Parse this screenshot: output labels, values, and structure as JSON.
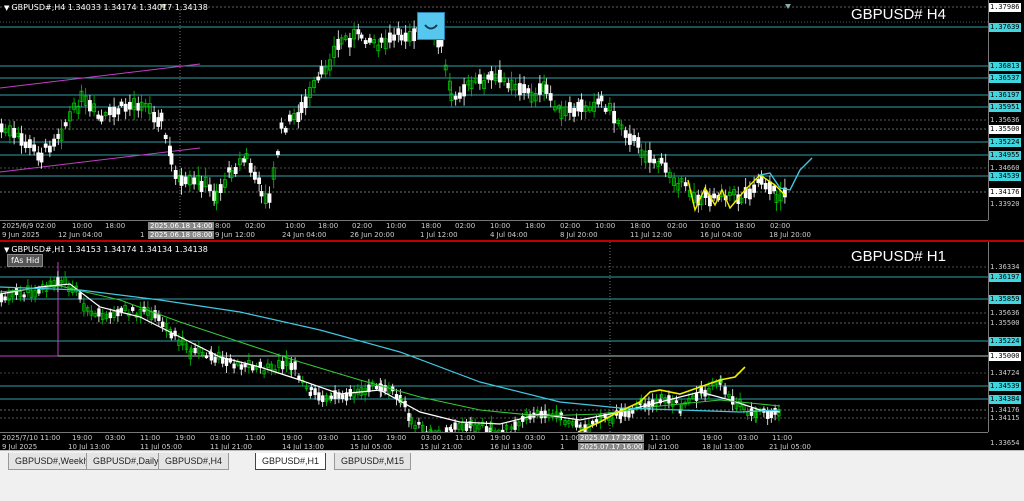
{
  "upper": {
    "header": "GBPUSD#,H4  1.34033 1.34174 1.34017 1.34138",
    "title": "GBPUSD# H4",
    "price_labels": [
      {
        "text": "1.37986",
        "style": "white"
      },
      {
        "text": "1.37639",
        "style": "cyan"
      },
      {
        "text": "1.36813",
        "style": "cyan"
      },
      {
        "text": "1.36537",
        "style": "cyan"
      },
      {
        "text": "1.36197",
        "style": "cyan"
      },
      {
        "text": "1.35951",
        "style": "cyan"
      },
      {
        "text": "1.35636",
        "style": "plain"
      },
      {
        "text": "1.35500",
        "style": "white"
      },
      {
        "text": "1.35224",
        "style": "cyan"
      },
      {
        "text": "1.34955",
        "style": "cyan"
      },
      {
        "text": "1.34660",
        "style": "plain"
      },
      {
        "text": "1.34539",
        "style": "cyan"
      },
      {
        "text": "1.34176",
        "style": "white"
      },
      {
        "text": "1.33920",
        "style": "plain"
      }
    ],
    "time_labels": [
      {
        "text": "2025/6/9 02:00",
        "hl": false
      },
      {
        "text": "10:00",
        "hl": false
      },
      {
        "text": "18:00",
        "hl": false
      },
      {
        "text": "2025.06.18 14:00",
        "hl": true
      },
      {
        "text": "8:00",
        "hl": false
      },
      {
        "text": "02:00",
        "hl": false
      },
      {
        "text": "10:00",
        "hl": false
      },
      {
        "text": "18:00",
        "hl": false
      },
      {
        "text": "02:00",
        "hl": false
      },
      {
        "text": "10:00",
        "hl": false
      },
      {
        "text": "18:00",
        "hl": false
      },
      {
        "text": "02:00",
        "hl": false
      },
      {
        "text": "10:00",
        "hl": false
      },
      {
        "text": "18:00",
        "hl": false
      },
      {
        "text": "02:00",
        "hl": false
      },
      {
        "text": "10:00",
        "hl": false
      },
      {
        "text": "18:00",
        "hl": false
      },
      {
        "text": "02:00",
        "hl": false
      },
      {
        "text": "10:00",
        "hl": false
      },
      {
        "text": "18:00",
        "hl": false
      },
      {
        "text": "02:00",
        "hl": false
      }
    ],
    "date_labels": [
      {
        "text": "9 Jun 2025",
        "hl": false
      },
      {
        "text": "12 Jun 04:00",
        "hl": false
      },
      {
        "text": "1",
        "hl": false
      },
      {
        "text": "2025.06.18 08:00",
        "hl": true
      },
      {
        "text": "9 Jun 12:00",
        "hl": false
      },
      {
        "text": "24 Jun 04:00",
        "hl": false
      },
      {
        "text": "26 Jun 20:00",
        "hl": false
      },
      {
        "text": "1 Jul 12:00",
        "hl": false
      },
      {
        "text": "4 Jul 04:00",
        "hl": false
      },
      {
        "text": "8 Jul 20:00",
        "hl": false
      },
      {
        "text": "11 Jul 12:00",
        "hl": false
      },
      {
        "text": "16 Jul 04:00",
        "hl": false
      },
      {
        "text": "18 Jul 20:00",
        "hl": false
      }
    ]
  },
  "lower": {
    "header": "GBPUSD#,H1  1.34153 1.34174 1.34134 1.34138",
    "title": "GBPUSD# H1",
    "tag": "fAs Hid",
    "price_labels": [
      {
        "text": "1.36334",
        "style": "plain"
      },
      {
        "text": "1.36197",
        "style": "cyan"
      },
      {
        "text": "1.35859",
        "style": "cyan"
      },
      {
        "text": "1.35636",
        "style": "plain"
      },
      {
        "text": "1.35500",
        "style": "plain"
      },
      {
        "text": "1.35224",
        "style": "cyan"
      },
      {
        "text": "1.35000",
        "style": "white"
      },
      {
        "text": "1.34724",
        "style": "plain"
      },
      {
        "text": "1.34539",
        "style": "cyan"
      },
      {
        "text": "1.34384",
        "style": "cyan"
      },
      {
        "text": "1.34176",
        "style": "plain"
      },
      {
        "text": "1.34115",
        "style": "plain"
      },
      {
        "text": "1.33654",
        "style": "plain"
      }
    ],
    "time_labels": [
      {
        "text": "2025/7/10 11:00",
        "hl": false
      },
      {
        "text": "19:00",
        "hl": false
      },
      {
        "text": "03:00",
        "hl": false
      },
      {
        "text": "11:00",
        "hl": false
      },
      {
        "text": "19:00",
        "hl": false
      },
      {
        "text": "03:00",
        "hl": false
      },
      {
        "text": "11:00",
        "hl": false
      },
      {
        "text": "19:00",
        "hl": false
      },
      {
        "text": "03:00",
        "hl": false
      },
      {
        "text": "11:00",
        "hl": false
      },
      {
        "text": "19:00",
        "hl": false
      },
      {
        "text": "03:00",
        "hl": false
      },
      {
        "text": "11:00",
        "hl": false
      },
      {
        "text": "19:00",
        "hl": false
      },
      {
        "text": "03:00",
        "hl": false
      },
      {
        "text": "11:00",
        "hl": false
      },
      {
        "text": "2025.07.17 22:00",
        "hl": true
      },
      {
        "text": "11:00",
        "hl": false
      },
      {
        "text": "19:00",
        "hl": false
      },
      {
        "text": "03:00",
        "hl": false
      },
      {
        "text": "11:00",
        "hl": false
      }
    ],
    "date_labels": [
      {
        "text": "9 Jul 2025",
        "hl": false
      },
      {
        "text": "10 Jul 13:00",
        "hl": false
      },
      {
        "text": "11 Jul 05:00",
        "hl": false
      },
      {
        "text": "11 Jul 21:00",
        "hl": false
      },
      {
        "text": "14 Jul 13:00",
        "hl": false
      },
      {
        "text": "15 Jul 05:00",
        "hl": false
      },
      {
        "text": "15 Jul 21:00",
        "hl": false
      },
      {
        "text": "16 Jul 13:00",
        "hl": false
      },
      {
        "text": "1",
        "hl": false
      },
      {
        "text": "2025.07.17 16:00",
        "hl": true
      },
      {
        "text": "Jul 21:00",
        "hl": false
      },
      {
        "text": "18 Jul 13:00",
        "hl": false
      },
      {
        "text": "21 Jul 05:00",
        "hl": false
      }
    ]
  },
  "tabs": [
    {
      "label": "GBPUSD#,Weekly",
      "active": false
    },
    {
      "label": "GBPUSD#,Daily",
      "active": false
    },
    {
      "label": "GBPUSD#,H4",
      "active": false
    },
    {
      "label": "GBPUSD#,H1",
      "active": true
    },
    {
      "label": "GBPUSD#,M15",
      "active": false
    }
  ],
  "colors": {
    "bull_candle": "#00c800",
    "bear_candle": "#ffffff",
    "level_line": "#3fd6e0",
    "ma_white": "#ffffff",
    "ma_green": "#34c834",
    "ma_cyan": "#3fc8e0",
    "trend_yellow": "#f0f000",
    "channel_magenta": "#c040c0",
    "separator": "#c00000"
  },
  "icons": [
    "smiley-expert-icon",
    "down-arrow-icon"
  ]
}
